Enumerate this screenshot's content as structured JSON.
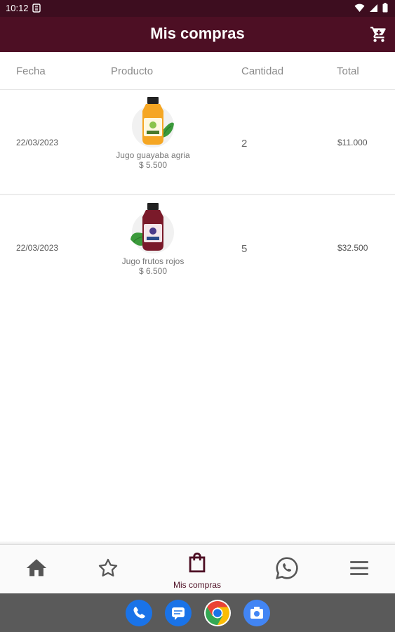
{
  "status_bar": {
    "time": "10:12"
  },
  "app_bar": {
    "title": "Mis compras",
    "cart_icon": "cart-icon"
  },
  "table": {
    "headers": [
      "Fecha",
      "Producto",
      "Cantidad",
      "Total"
    ],
    "rows": [
      {
        "date": "22/03/2023",
        "product_name": "Jugo guayaba agria",
        "product_price": "$ 5.500",
        "quantity": "2",
        "total": "$11.000",
        "bottle_color": "#f5a623"
      },
      {
        "date": "22/03/2023",
        "product_name": "Jugo frutos rojos",
        "product_price": "$ 6.500",
        "quantity": "5",
        "total": "$32.500",
        "bottle_color": "#7a1a2a"
      }
    ]
  },
  "bottom_nav": {
    "items": [
      {
        "icon": "home-icon",
        "label": ""
      },
      {
        "icon": "star-icon",
        "label": ""
      },
      {
        "icon": "shopping-bag-icon",
        "label": "Mis compras",
        "active": true
      },
      {
        "icon": "whatsapp-icon",
        "label": ""
      },
      {
        "icon": "menu-icon",
        "label": ""
      }
    ]
  },
  "dock": {
    "apps": [
      "phone-icon",
      "messages-icon",
      "chrome-icon",
      "camera-icon"
    ]
  },
  "colors": {
    "primary": "#4d0f24",
    "status_bar": "#3d0d1f",
    "active_nav": "#4d0f24"
  }
}
